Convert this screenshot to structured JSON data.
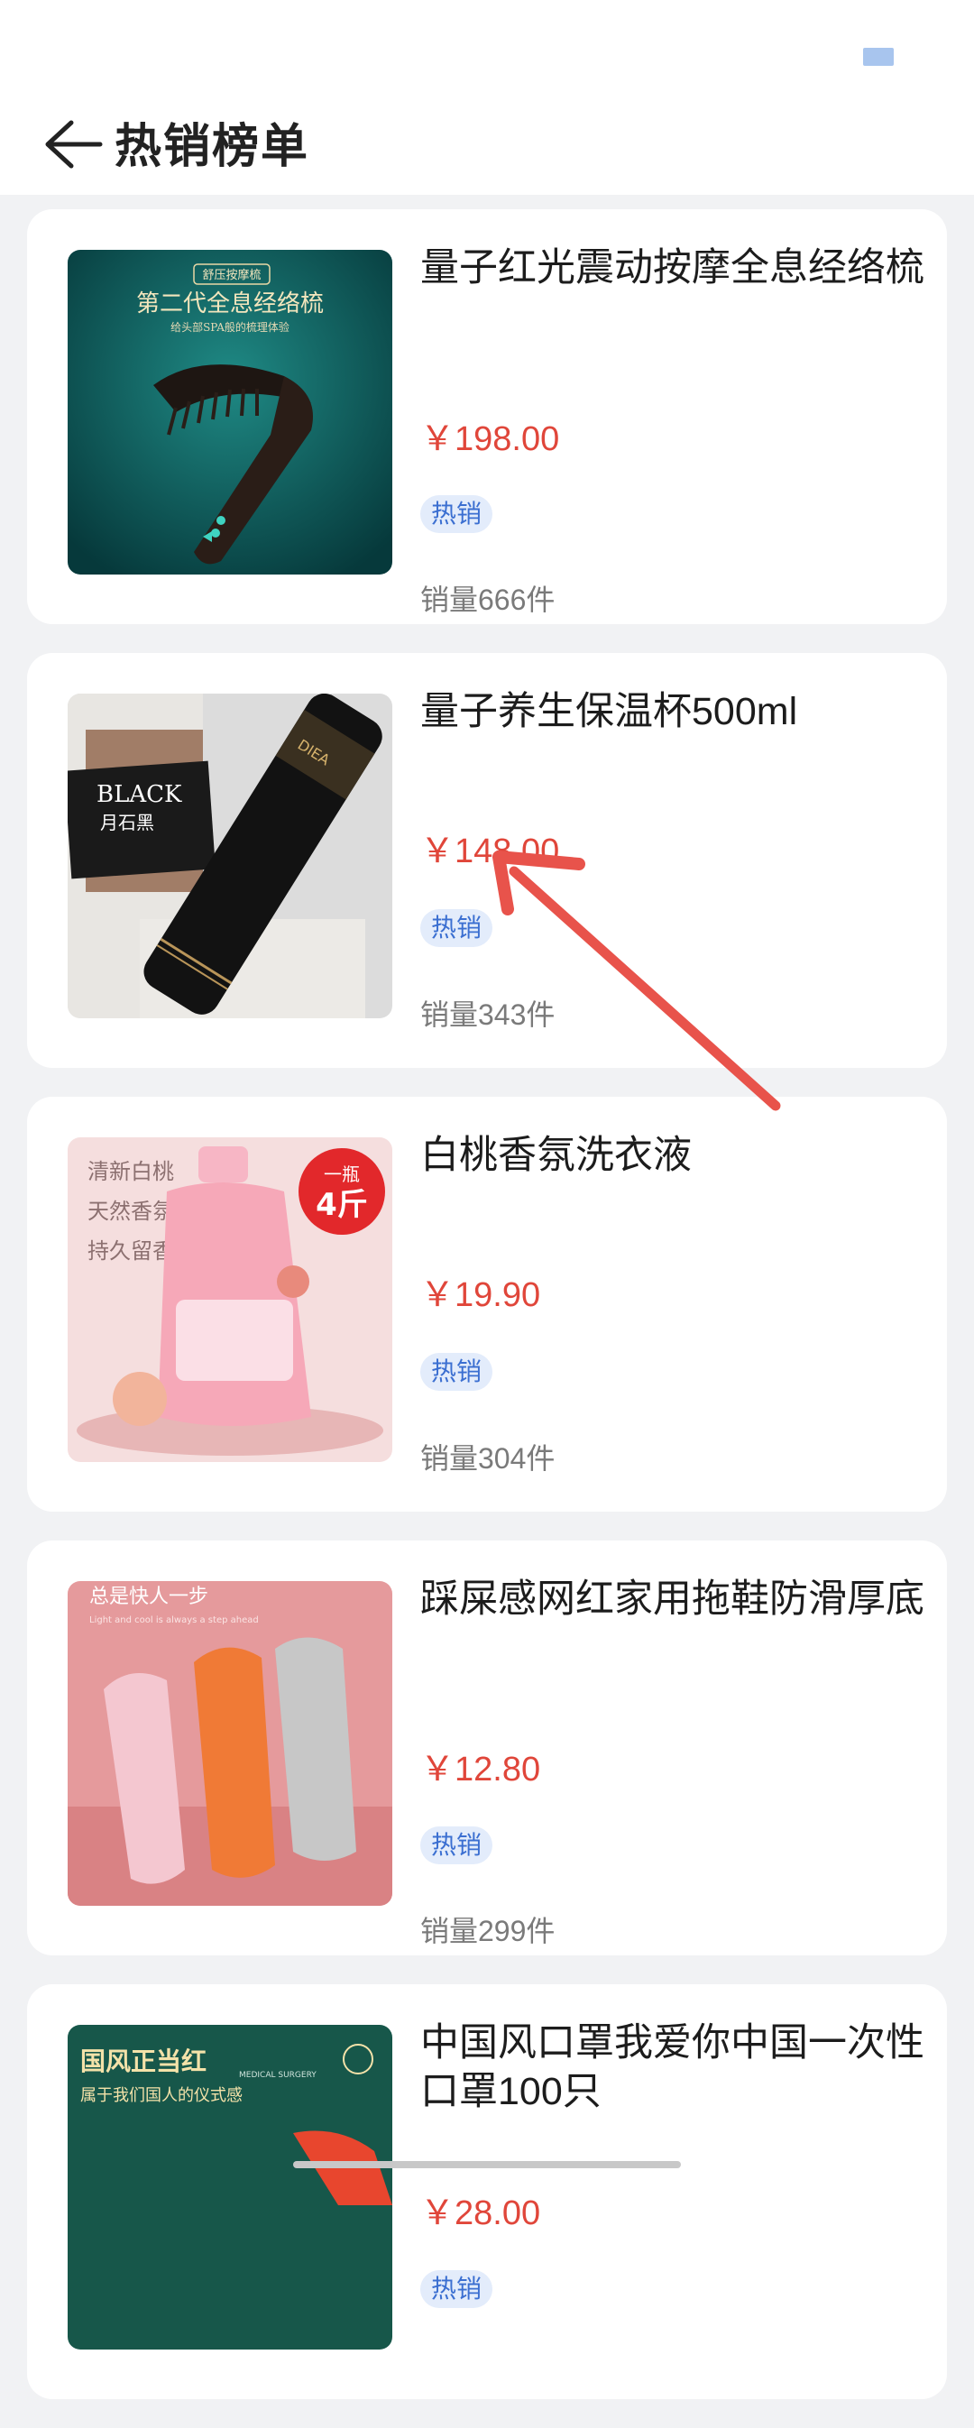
{
  "header": {
    "title": "热销榜单"
  },
  "products": [
    {
      "title": "量子红光震动按摩全息经络梳",
      "price": "￥198.00",
      "badge": "热销",
      "sales": "销量666件",
      "image_text": [
        "舒压按摩梳",
        "第二代全息经络梳",
        "给头部SPA般的梳理体验"
      ]
    },
    {
      "title": "量子养生保温杯500ml",
      "price": "￥148.00",
      "badge": "热销",
      "sales": "销量343件",
      "image_text": [
        "BLACK",
        "月石黑",
        "DIEA"
      ]
    },
    {
      "title": "白桃香氛洗衣液",
      "price": "￥19.90",
      "badge": "热销",
      "sales": "销量304件",
      "image_text": [
        "清新白桃",
        "天然香氛",
        "持久留香",
        "一瓶",
        "4斤"
      ]
    },
    {
      "title": "踩屎感网红家用拖鞋防滑厚底",
      "price": "￥12.80",
      "badge": "热销",
      "sales": "销量299件",
      "image_text": [
        "总是快人一步",
        "Light and cool is always a step ahead"
      ]
    },
    {
      "title": "中国风口罩我爱你中国一次性口罩100只",
      "price": "￥28.00",
      "badge": "热销",
      "sales": "",
      "image_text": [
        "国风正当红",
        "属于我们国人的仪式感",
        "MEDICAL SURGERY"
      ]
    }
  ],
  "colors": {
    "background": "#f1f2f4",
    "price": "#e0463a",
    "badge_text": "#3b6fd1",
    "badge_bg": "#e3ecfb",
    "annotation_arrow": "#e8534b"
  }
}
